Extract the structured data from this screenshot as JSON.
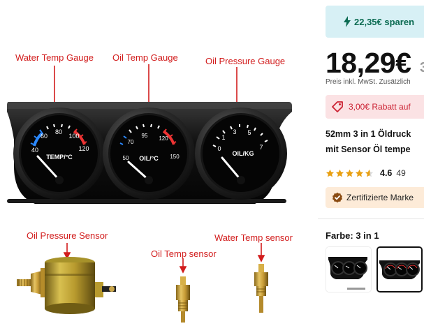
{
  "image": {
    "labels": {
      "water_temp_gauge": "Water Temp Gauge",
      "oil_temp_gauge": "Oil Temp Gauge",
      "oil_pressure_gauge": "Oil Pressure Gauge",
      "oil_pressure_sensor": "Oil Pressure Sensor",
      "oil_temp_sensor": "Oil Temp sensor",
      "water_temp_sensor": "Water Temp sensor"
    },
    "gauges": [
      {
        "name": "TEMP/°C",
        "ticks": [
          "40",
          "60",
          "80",
          "100",
          "120"
        ]
      },
      {
        "name": "OIL/°C",
        "ticks": [
          "50",
          "70",
          "95",
          "120",
          "150"
        ]
      },
      {
        "name": "OIL/KG",
        "ticks": [
          "0",
          "1",
          "3",
          "5",
          "7"
        ]
      }
    ]
  },
  "savings": {
    "text": "22,35€ sparen"
  },
  "price": {
    "current": "18,29€",
    "old": "3"
  },
  "tax_note": "Preis inkl. MwSt. Zusätzlich",
  "discount": {
    "text": "3,00€ Rabatt auf"
  },
  "title": {
    "line1": "52mm 3 in 1 Öldruck",
    "line2": "mit Sensor Öl tempe"
  },
  "rating": {
    "value": "4.6",
    "count": "49",
    "stars": 4.6
  },
  "verified": {
    "text": "Zertifizierte Marke"
  },
  "color": {
    "label": "Farbe: 3 in 1"
  },
  "colors": {
    "accent_green": "#0b6b52",
    "discount_red": "#cc2233",
    "star_gold": "#e8a013",
    "label_red": "#d21d1d"
  }
}
